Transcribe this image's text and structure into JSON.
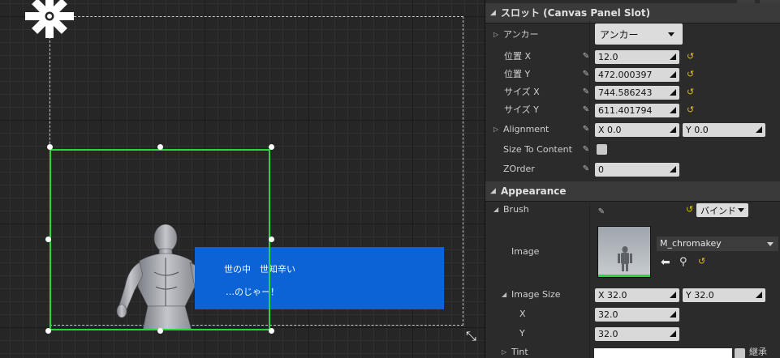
{
  "canvas": {
    "dialog_text_line1": "世の中　世知辛い",
    "dialog_text_line2": "…のじゃー！"
  },
  "slot": {
    "header": "スロット (Canvas Panel Slot)",
    "anchor_label": "アンカー",
    "anchor_dropdown": "アンカー",
    "position_x_label": "位置 X",
    "position_x": "12.0",
    "position_y_label": "位置 Y",
    "position_y": "472.000397",
    "size_x_label": "サイズ X",
    "size_x": "744.586243",
    "size_y_label": "サイズ Y",
    "size_y": "611.401794",
    "alignment_label": "Alignment",
    "alignment_x": "X  0.0",
    "alignment_y": "Y  0.0",
    "size_to_content_label": "Size To Content",
    "zorder_label": "ZOrder",
    "zorder": "0"
  },
  "appearance": {
    "header": "Appearance",
    "brush_label": "Brush",
    "bind_button": "バインド",
    "image_label": "Image",
    "material": "M_chromakey",
    "image_size_label": "Image Size",
    "image_size_x": "X  32.0",
    "image_size_y": "Y  32.0",
    "x_label": "X",
    "x_value": "32.0",
    "y_label": "Y",
    "y_value": "32.0",
    "tint_label": "Tint",
    "inherit_label": "継承"
  },
  "colors": {
    "selection": "#27d63a",
    "text_box": "#0b63d6",
    "reset_arrow": "#e0c000"
  }
}
